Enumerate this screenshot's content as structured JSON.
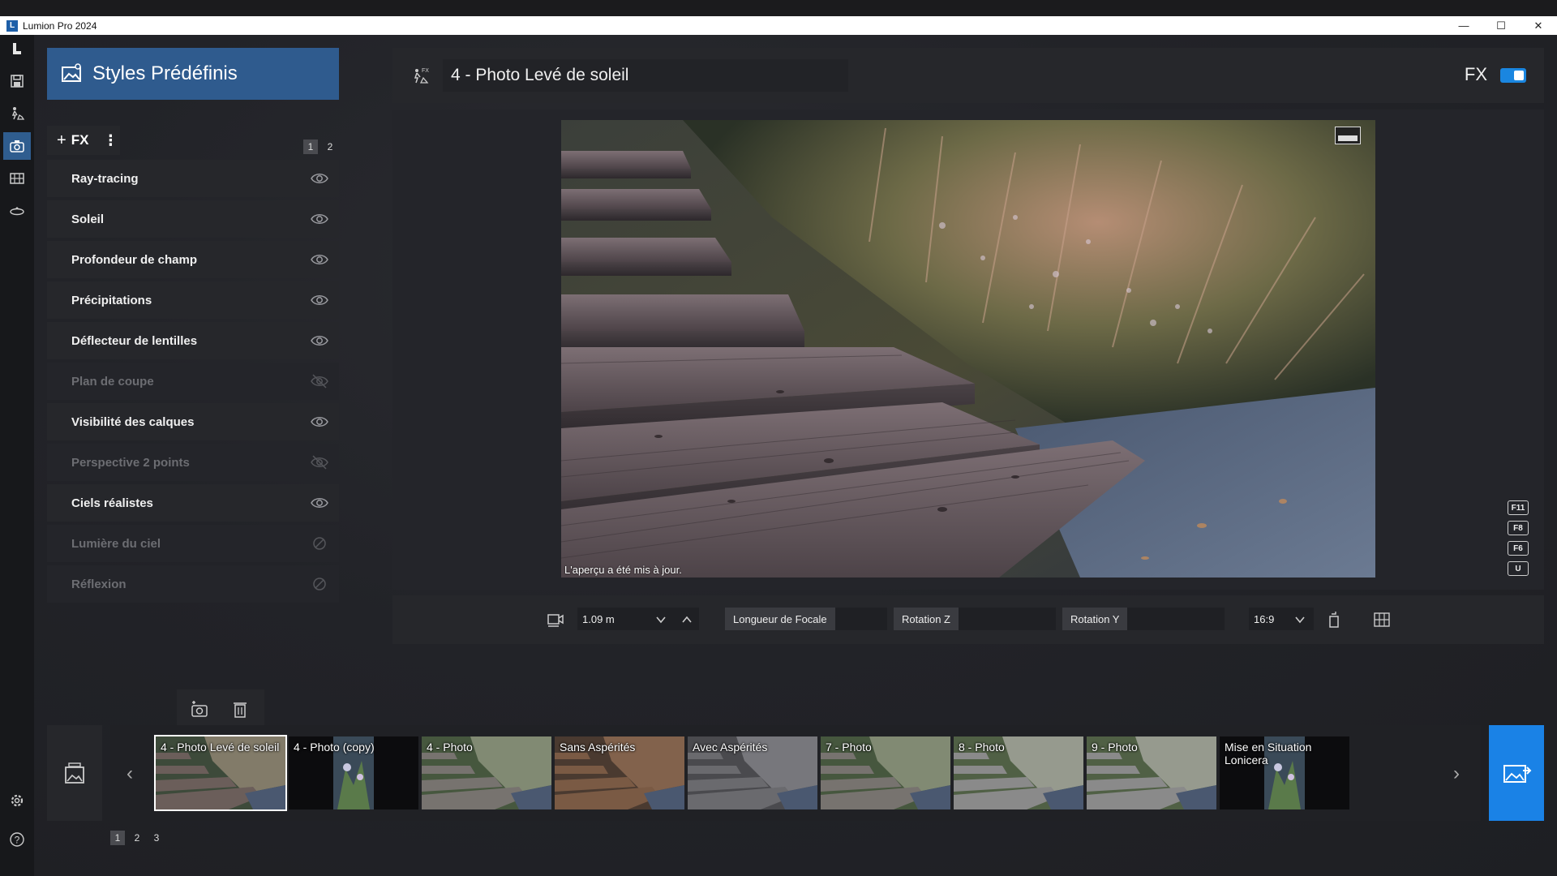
{
  "window": {
    "title": "Lumion Pro 2024"
  },
  "window_controls": {
    "minimize": "—",
    "maximize": "☐",
    "close": "✕"
  },
  "panel": {
    "title": "Styles Prédéfinis",
    "add_fx_label": "FX",
    "pages": [
      "1",
      "2"
    ]
  },
  "fx_items": [
    {
      "label": "Ray-tracing",
      "state": "visible"
    },
    {
      "label": "Soleil",
      "state": "visible"
    },
    {
      "label": "Profondeur de champ",
      "state": "visible"
    },
    {
      "label": "Précipitations",
      "state": "visible"
    },
    {
      "label": "Déflecteur de lentilles",
      "state": "visible"
    },
    {
      "label": "Plan de coupe",
      "state": "hidden"
    },
    {
      "label": "Visibilité des calques",
      "state": "visible"
    },
    {
      "label": "Perspective 2 points",
      "state": "hidden"
    },
    {
      "label": "Ciels réalistes",
      "state": "visible"
    },
    {
      "label": "Lumière du ciel",
      "state": "disabled"
    },
    {
      "label": "Réflexion",
      "state": "disabled"
    }
  ],
  "preview": {
    "title": "4 - Photo Levé de soleil",
    "fx_label": "FX",
    "fx_toggle": true,
    "status_message": "L'aperçu a été mis à jour.",
    "shortcut_keys": [
      "F11",
      "F8",
      "F6",
      "U"
    ]
  },
  "controls": {
    "camera_height": "1.09 m",
    "focal_label": "Longueur de Focale",
    "rotation_z_label": "Rotation Z",
    "rotation_y_label": "Rotation Y",
    "aspect_ratio": "16:9"
  },
  "filmstrip": {
    "thumbnails": [
      {
        "label": "4 - Photo Levé de soleil",
        "selected": true,
        "style": "stairs-sunset"
      },
      {
        "label": "4 - Photo (copy)",
        "selected": false,
        "style": "portrait-plant"
      },
      {
        "label": "4 - Photo",
        "selected": false,
        "style": "stairs-day"
      },
      {
        "label": "Sans Aspérités",
        "selected": false,
        "style": "stairs-warm"
      },
      {
        "label": "Avec Aspérités",
        "selected": false,
        "style": "stairs-grey"
      },
      {
        "label": "7 - Photo",
        "selected": false,
        "style": "stairs-day"
      },
      {
        "label": "8 - Photo",
        "selected": false,
        "style": "stairs-bright"
      },
      {
        "label": "9 - Photo",
        "selected": false,
        "style": "stairs-bright"
      },
      {
        "label": "Mise en Situation Lonicera",
        "selected": false,
        "style": "portrait-plant"
      }
    ],
    "pages": [
      "1",
      "2",
      "3"
    ]
  },
  "colors": {
    "accent": "#1a82e6",
    "header": "#2f5b8e",
    "panel": "#26272b"
  }
}
